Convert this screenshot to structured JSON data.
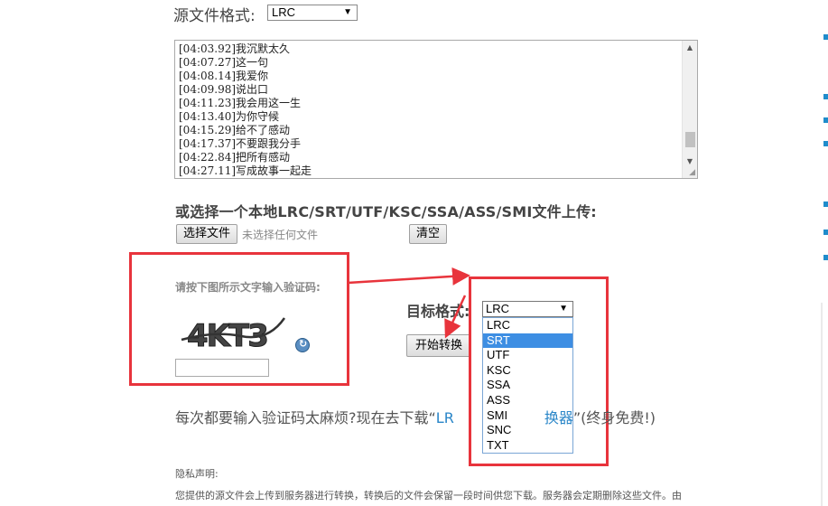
{
  "source": {
    "label": "源文件格式:",
    "selected": "LRC"
  },
  "lyrics": [
    "[04:03.92]我沉默太久",
    "[04:07.27]这一句",
    "[04:08.14]我爱你",
    "[04:09.98]说出口",
    "[04:11.23]我会用这一生",
    "[04:13.40]为你守候",
    "[04:15.29]给不了感动",
    "[04:17.37]不要跟我分手",
    "[04:22.84]把所有感动",
    "[04:27.11]写成故事一起走"
  ],
  "upload": {
    "heading": "或选择一个本地LRC/SRT/UTF/KSC/SSA/ASS/SMI文件上传:",
    "choose_label": "选择文件",
    "no_file_text": "未选择任何文件",
    "clear_label": "清空"
  },
  "captcha": {
    "hint": "请按下图所示文字输入验证码:",
    "image_text": "4KT3",
    "input_value": ""
  },
  "target": {
    "label": "目标格式:",
    "selected": "LRC",
    "options": [
      "LRC",
      "SRT",
      "UTF",
      "KSC",
      "SSA",
      "ASS",
      "SMI",
      "SNC",
      "TXT"
    ],
    "highlighted": "SRT"
  },
  "convert": {
    "start_label": "开始转换"
  },
  "download": {
    "prefix": "每次都要输入验证码太麻烦?现在去下载“",
    "link_start": "LR",
    "link_end": "换器",
    "suffix": "”(终身免费!)"
  },
  "privacy": {
    "title": "隐私声明:",
    "text": "您提供的源文件会上传到服务器进行转换，转换后的文件会保留一段时间供您下载。服务器会定期删除这些文件。由"
  },
  "colors": {
    "annotation_red": "#e8343c",
    "link_blue": "#2a86c8",
    "highlight_blue": "#3d8ee3"
  }
}
